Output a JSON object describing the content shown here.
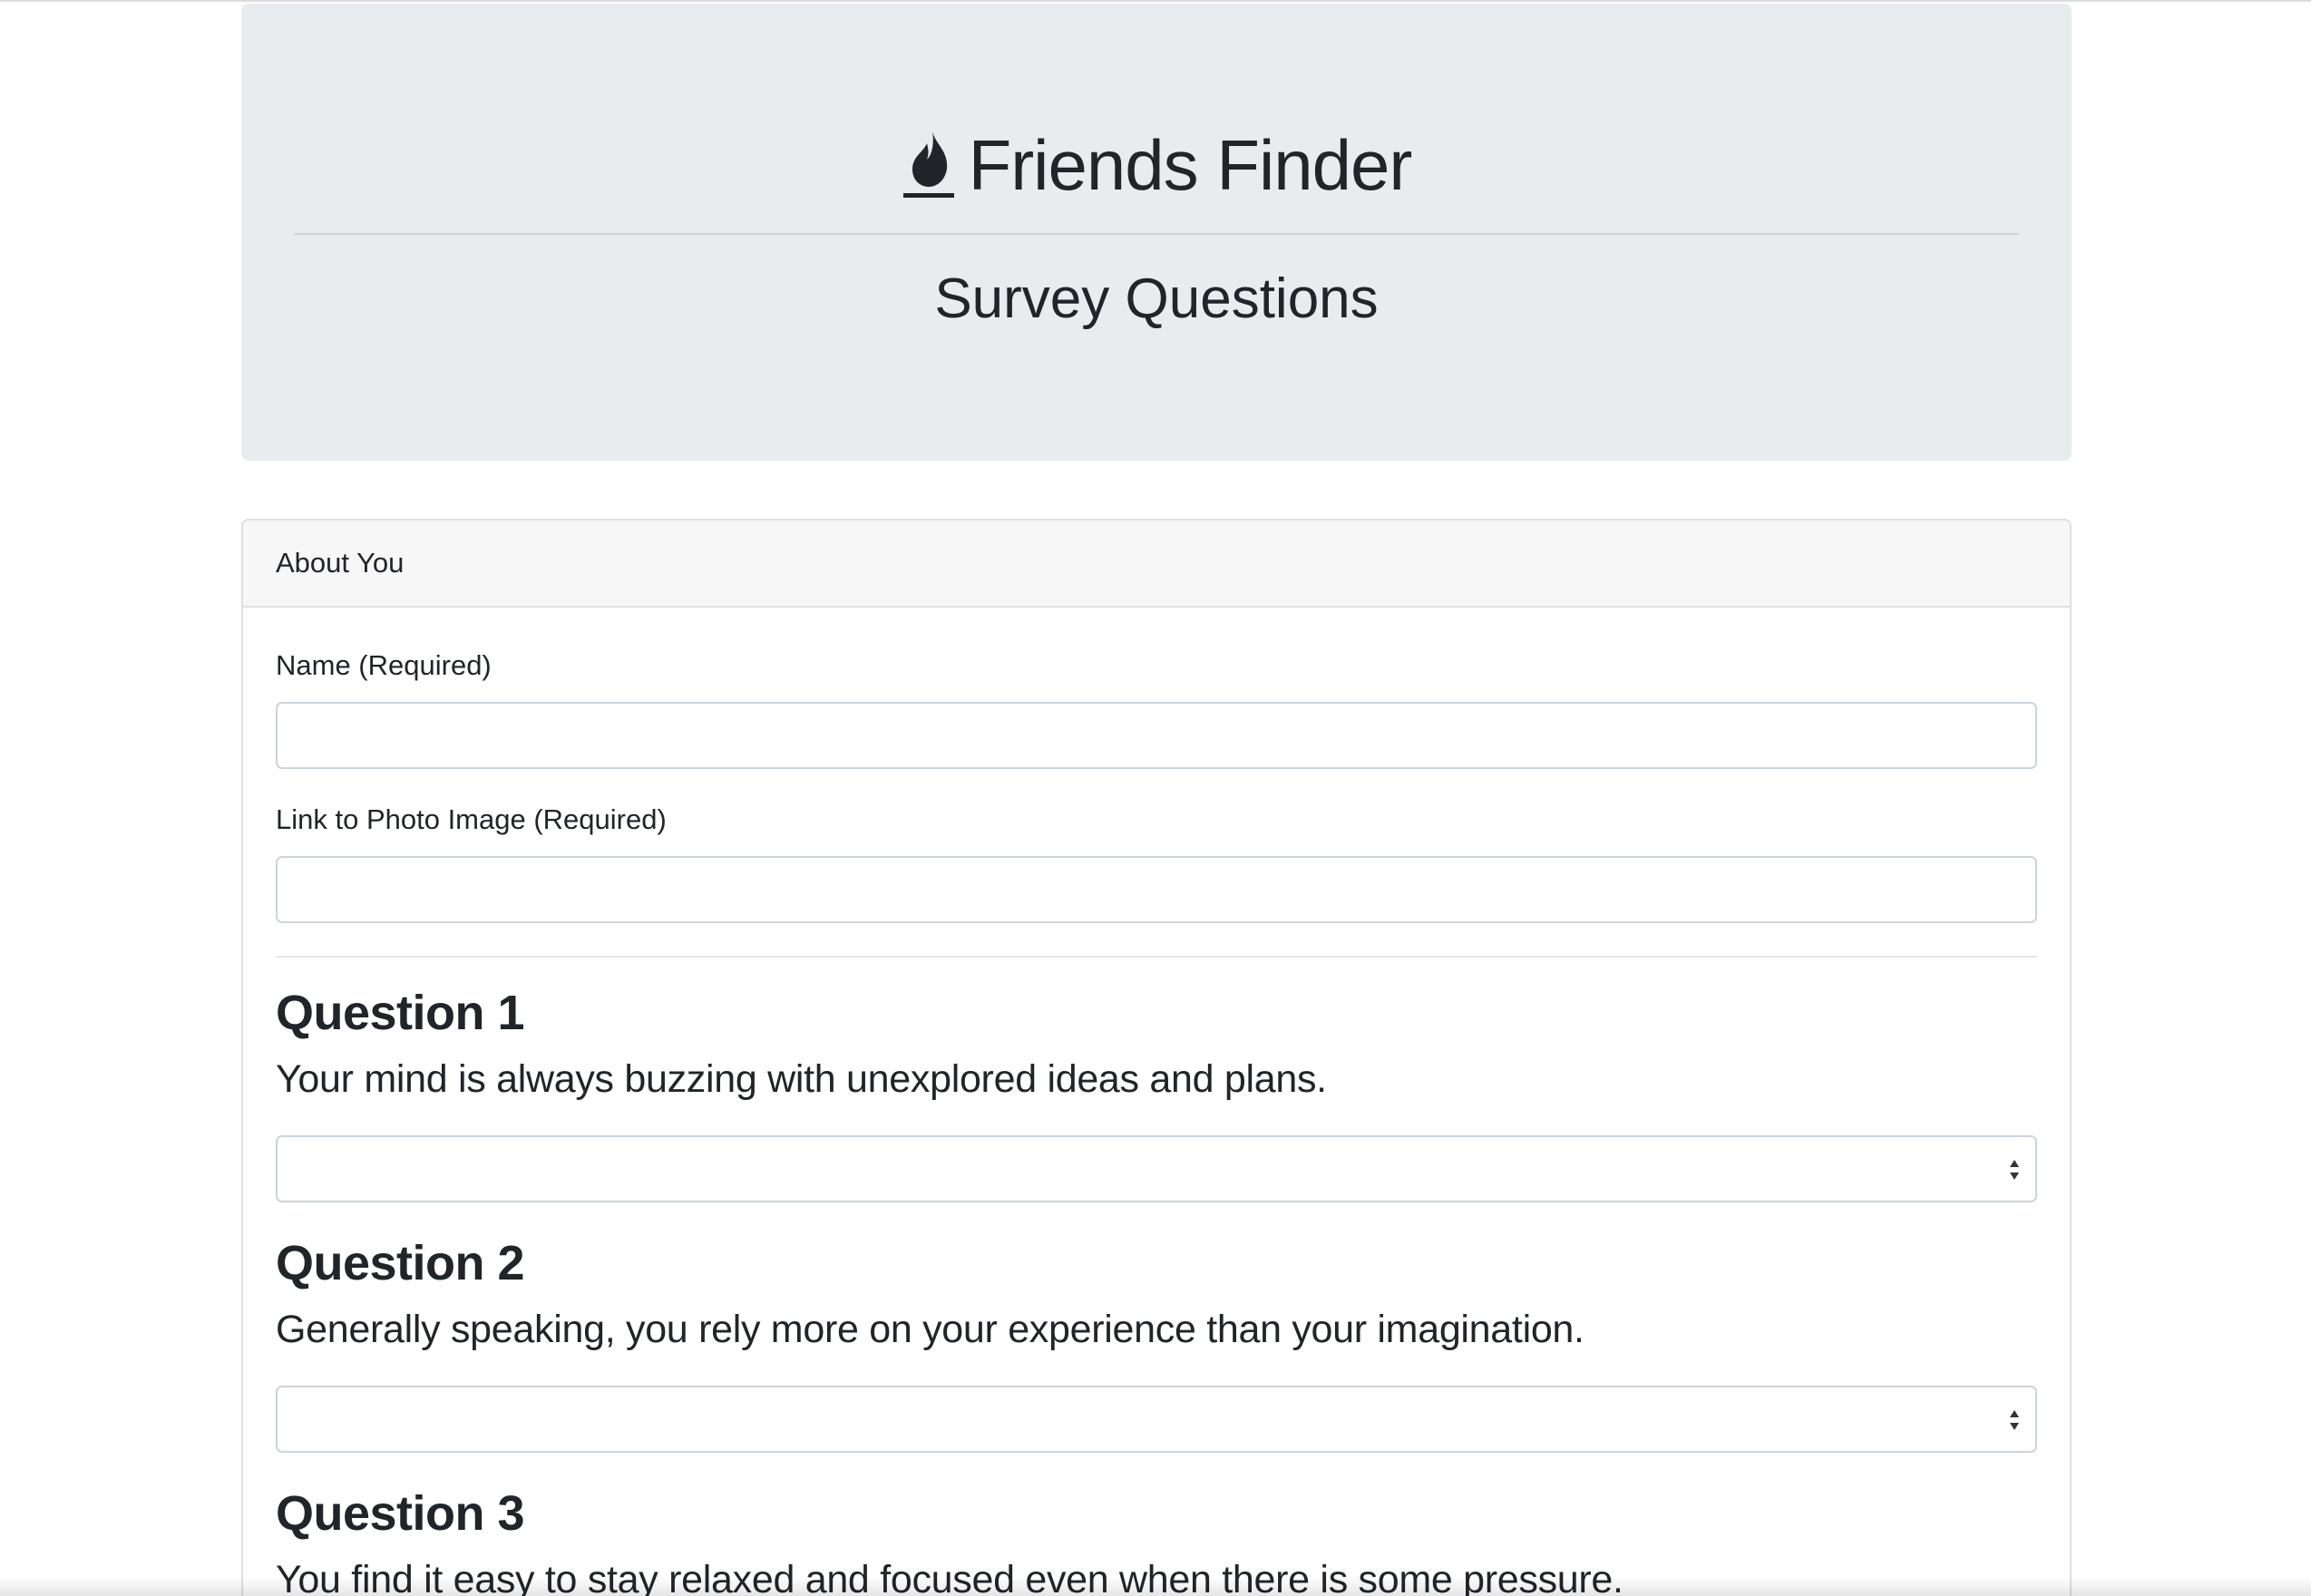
{
  "header": {
    "brand_icon": "fire-icon",
    "title": "Friends Finder",
    "subtitle": "Survey Questions"
  },
  "card": {
    "header": "About You",
    "name_label": "Name (Required)",
    "name_value": "",
    "photo_label": "Link to Photo Image (Required)",
    "photo_value": "",
    "questions": [
      {
        "title": "Question 1",
        "text": "Your mind is always buzzing with unexplored ideas and plans.",
        "selected": ""
      },
      {
        "title": "Question 2",
        "text": "Generally speaking, you rely more on your experience than your imagination.",
        "selected": ""
      },
      {
        "title": "Question 3",
        "text": "You find it easy to stay relaxed and focused even when there is some pressure."
      }
    ]
  }
}
